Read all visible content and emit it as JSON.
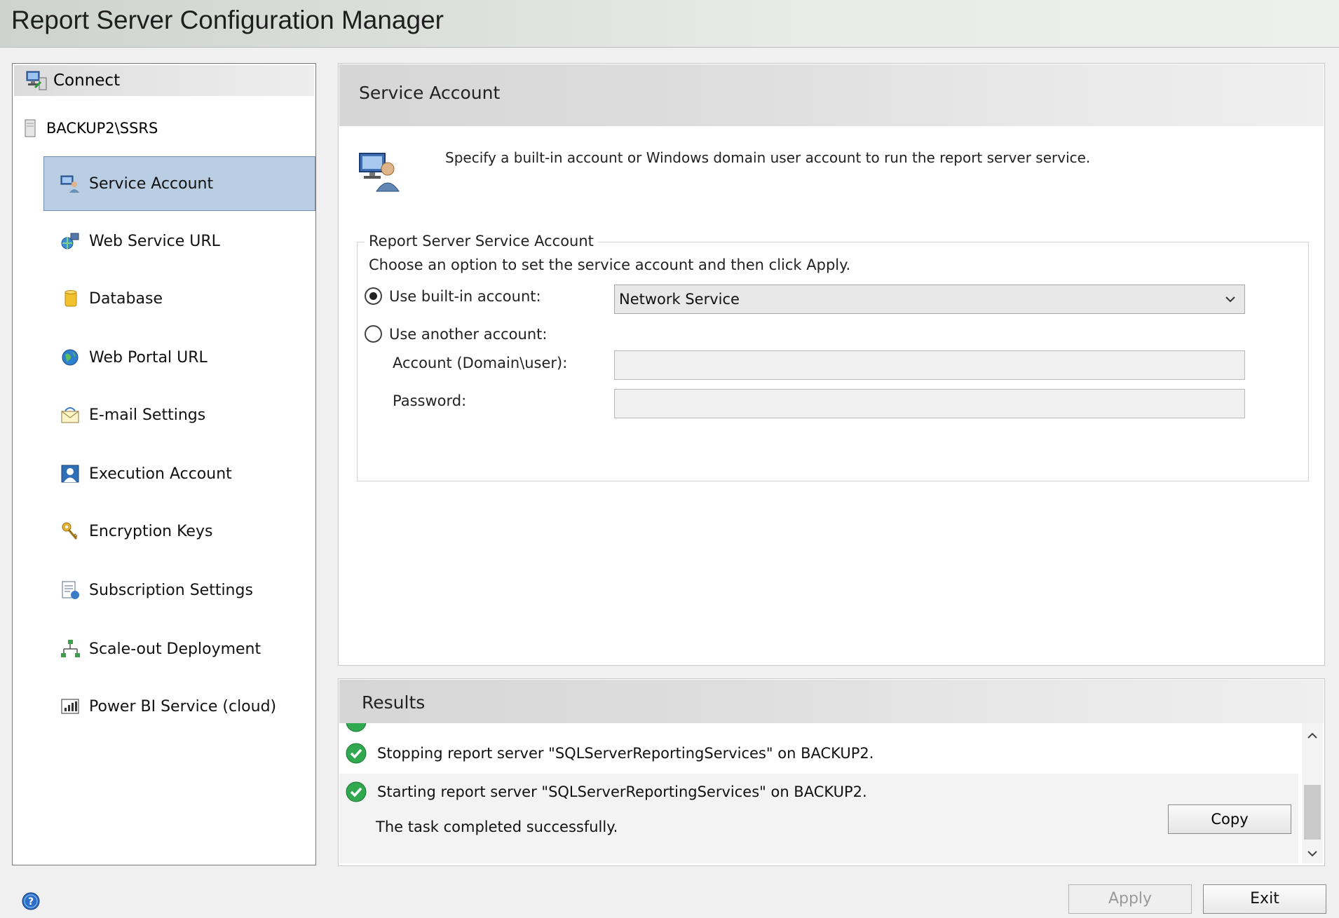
{
  "window": {
    "title": "Report Server Configuration Manager"
  },
  "nav": {
    "connect_label": "Connect",
    "server_label": "BACKUP2\\SSRS",
    "items": [
      {
        "label": "Service Account",
        "icon": "service-account-icon",
        "selected": true
      },
      {
        "label": "Web Service URL",
        "icon": "web-service-url-icon"
      },
      {
        "label": "Database",
        "icon": "database-icon"
      },
      {
        "label": "Web Portal URL",
        "icon": "globe-icon"
      },
      {
        "label": "E-mail Settings",
        "icon": "email-icon"
      },
      {
        "label": "Execution Account",
        "icon": "execution-account-icon"
      },
      {
        "label": "Encryption Keys",
        "icon": "keys-icon"
      },
      {
        "label": "Subscription Settings",
        "icon": "subscription-icon"
      },
      {
        "label": "Scale-out Deployment",
        "icon": "scale-out-icon"
      },
      {
        "label": "Power BI Service (cloud)",
        "icon": "power-bi-icon"
      }
    ]
  },
  "main": {
    "header": "Service Account",
    "description": "Specify a built-in account or Windows domain user account to run the report server service.",
    "group": {
      "legend": "Report Server Service Account",
      "instruction": "Choose an option to set the service account and then click Apply.",
      "builtin_label": "Use built-in account:",
      "builtin_value": "Network Service",
      "another_label": "Use another account:",
      "account_label": "Account (Domain\\user):",
      "account_value": "",
      "password_label": "Password:",
      "password_value": ""
    }
  },
  "results": {
    "header": "Results",
    "rows": [
      "Stopping report server \"SQLServerReportingServices\" on BACKUP2.",
      "Starting report server \"SQLServerReportingServices\" on BACKUP2."
    ],
    "final_message": "The task completed successfully.",
    "copy_label": "Copy"
  },
  "footer": {
    "apply_label": "Apply",
    "exit_label": "Exit"
  },
  "colors": {
    "selected_bg": "#b9cde3",
    "selected_border": "#6f8fb3",
    "success_green": "#2fa84f"
  }
}
